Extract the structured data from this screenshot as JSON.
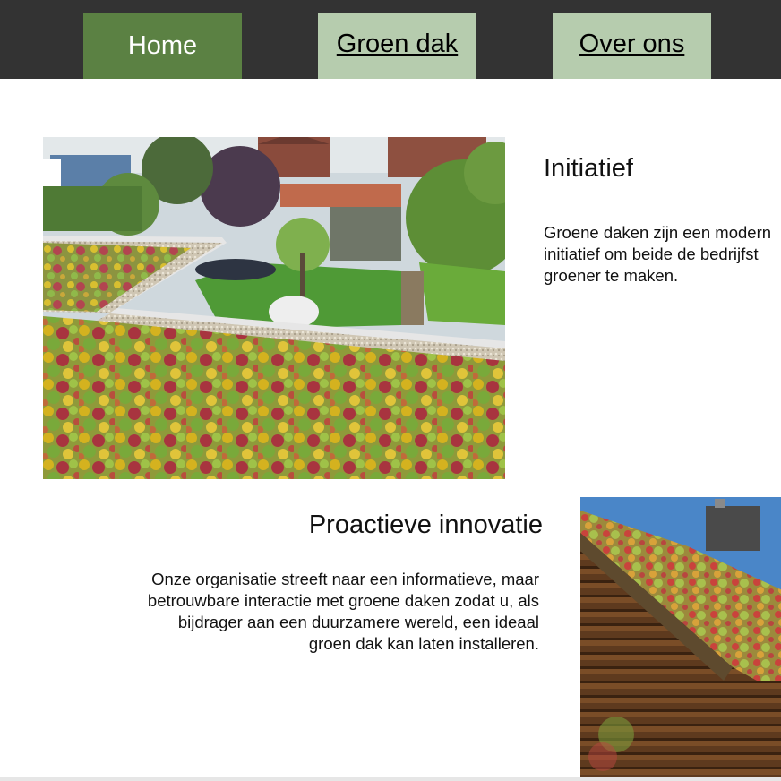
{
  "nav": {
    "items": [
      {
        "label": "Home",
        "active": true
      },
      {
        "label": "Groen dak",
        "active": false
      },
      {
        "label": "Over ons",
        "active": false
      }
    ]
  },
  "sections": {
    "initiatief": {
      "title": "Initiatief",
      "lines": [
        "Groene daken zijn een modern",
        "initiatief om beide de bedrijfst",
        "groener te maken."
      ]
    },
    "proactief": {
      "title": "Proactieve innovatie",
      "lines": [
        "Onze organisatie streeft naar een informatieve, maar",
        "betrouwbare interactie met groene daken zodat u, als",
        "bijdrager aan een duurzamere wereld, een ideaal",
        "groen dak kan laten installeren."
      ]
    }
  },
  "images": {
    "roof": "green-sedum-roof-photo",
    "cabin": "log-cabin-green-roof-photo"
  },
  "colors": {
    "navbar": "#333333",
    "active": "#5b8143",
    "inactive": "#b6ccae"
  }
}
